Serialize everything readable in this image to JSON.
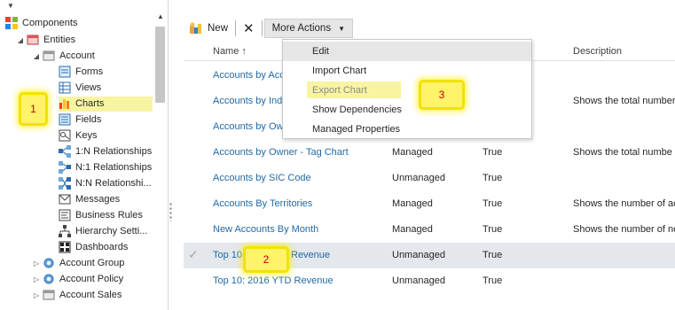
{
  "tree": {
    "root": "Components",
    "entities": "Entities",
    "account": "Account",
    "account_children": [
      "Forms",
      "Views",
      "Charts",
      "Fields",
      "Keys",
      "1:N Relationships",
      "N:1 Relationships",
      "N:N Relationshi...",
      "Messages",
      "Business Rules",
      "Hierarchy Setti...",
      "Dashboards"
    ],
    "siblings": [
      "Account Group",
      "Account Policy",
      "Account Sales"
    ],
    "selected_item": "Charts"
  },
  "toolbar": {
    "new_label": "New",
    "delete_symbol": "✕",
    "more_actions_label": "More Actions"
  },
  "grid": {
    "columns": [
      "Name ↑",
      "Description"
    ],
    "rows": [
      {
        "name": "Accounts by Acc",
        "state": "",
        "customizable": "",
        "description": ""
      },
      {
        "name": "Accounts by Ind",
        "state": "",
        "customizable": "",
        "description": "Shows the total number"
      },
      {
        "name": "Accounts by Ow",
        "state": "",
        "customizable": "",
        "description": ""
      },
      {
        "name": "Accounts by Owner - Tag Chart",
        "state": "Managed",
        "customizable": "True",
        "description": "Shows the total numbe"
      },
      {
        "name": "Accounts by SIC Code",
        "state": "Unmanaged",
        "customizable": "True",
        "description": ""
      },
      {
        "name": "Accounts By Territories",
        "state": "Managed",
        "customizable": "True",
        "description": "Shows the number of ac"
      },
      {
        "name": "New Accounts By Month",
        "state": "Managed",
        "customizable": "True",
        "description": "Shows the number of ne"
      },
      {
        "name": "Top 10:",
        "name_tail": "Revenue",
        "state": "Unmanaged",
        "customizable": "True",
        "description": ""
      },
      {
        "name": "Top 10: 2016 YTD Revenue",
        "state": "Unmanaged",
        "customizable": "True",
        "description": ""
      }
    ],
    "header_fragment": "le"
  },
  "menu": {
    "items": [
      "Edit",
      "Import Chart",
      "Export Chart",
      "Show Dependencies",
      "Managed Properties"
    ]
  },
  "callouts": [
    "1",
    "2",
    "3"
  ],
  "colors": {
    "link": "#1f6aa5",
    "callout_fill": "#fff36a",
    "callout_number": "#c00000",
    "selected_row": "#e4e7ec",
    "menu_hover": "#e6e6e6"
  }
}
